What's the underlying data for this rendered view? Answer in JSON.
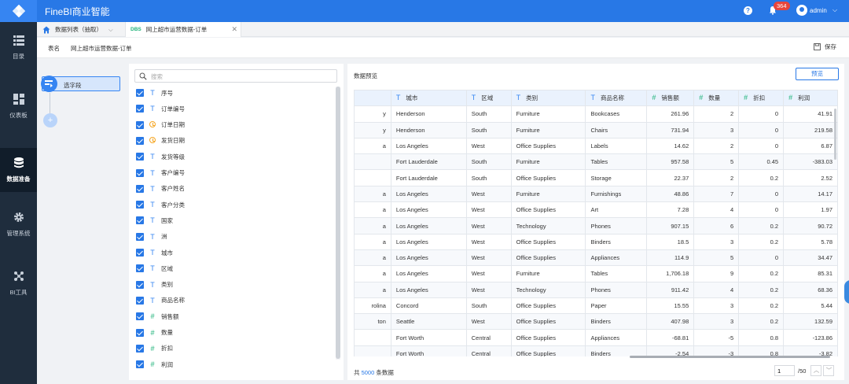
{
  "app": {
    "title": "FineBI商业智能"
  },
  "header": {
    "notification_count": "364",
    "user": "admin"
  },
  "rail": {
    "items": [
      {
        "label": "目录",
        "icon": "list-icon"
      },
      {
        "label": "仪表板",
        "icon": "dashboard-icon"
      },
      {
        "label": "数据准备",
        "icon": "database-icon",
        "active": true
      },
      {
        "label": "管理系统",
        "icon": "gear-icon"
      },
      {
        "label": "BI工具",
        "icon": "network-icon"
      }
    ]
  },
  "tabs": [
    {
      "label": "数据列表（抽取）"
    },
    {
      "badge": "DBS",
      "label": "网上超市运营数据-订单"
    }
  ],
  "namebar": {
    "label": "表名",
    "value": "网上超市运营数据-订单",
    "save": "保存"
  },
  "flow": {
    "node_label": "选字段",
    "add": "+"
  },
  "fields": {
    "search_placeholder": "搜索",
    "items": [
      {
        "type": "T",
        "name": "序号"
      },
      {
        "type": "T",
        "name": "订单编号"
      },
      {
        "type": "D",
        "name": "订单日期"
      },
      {
        "type": "D",
        "name": "发货日期"
      },
      {
        "type": "T",
        "name": "发货等级"
      },
      {
        "type": "T",
        "name": "客户编号"
      },
      {
        "type": "T",
        "name": "客户姓名"
      },
      {
        "type": "T",
        "name": "客户分类"
      },
      {
        "type": "T",
        "name": "国家"
      },
      {
        "type": "T",
        "name": "洲"
      },
      {
        "type": "T",
        "name": "城市"
      },
      {
        "type": "T",
        "name": "区域"
      },
      {
        "type": "T",
        "name": "类别"
      },
      {
        "type": "T",
        "name": "商品名称"
      },
      {
        "type": "#",
        "name": "销售额"
      },
      {
        "type": "#",
        "name": "数量"
      },
      {
        "type": "#",
        "name": "折扣"
      },
      {
        "type": "#",
        "name": "利润"
      }
    ]
  },
  "preview": {
    "title": "数据预览",
    "button": "预览",
    "columns": [
      {
        "type": "T",
        "name": ""
      },
      {
        "type": "T",
        "name": "城市"
      },
      {
        "type": "T",
        "name": "区域"
      },
      {
        "type": "T",
        "name": "类别"
      },
      {
        "type": "T",
        "name": "商品名称"
      },
      {
        "type": "#",
        "name": "销售额"
      },
      {
        "type": "#",
        "name": "数量"
      },
      {
        "type": "#",
        "name": "折扣"
      },
      {
        "type": "#",
        "name": "利润"
      }
    ],
    "rows": [
      [
        "y",
        "Henderson",
        "South",
        "Furniture",
        "Bookcases",
        "261.96",
        "2",
        "0",
        "41.91"
      ],
      [
        "y",
        "Henderson",
        "South",
        "Furniture",
        "Chairs",
        "731.94",
        "3",
        "0",
        "219.58"
      ],
      [
        "a",
        "Los Angeles",
        "West",
        "Office Supplies",
        "Labels",
        "14.62",
        "2",
        "0",
        "6.87"
      ],
      [
        "",
        "Fort Lauderdale",
        "South",
        "Furniture",
        "Tables",
        "957.58",
        "5",
        "0.45",
        "-383.03"
      ],
      [
        "",
        "Fort Lauderdale",
        "South",
        "Office Supplies",
        "Storage",
        "22.37",
        "2",
        "0.2",
        "2.52"
      ],
      [
        "a",
        "Los Angeles",
        "West",
        "Furniture",
        "Furnishings",
        "48.86",
        "7",
        "0",
        "14.17"
      ],
      [
        "a",
        "Los Angeles",
        "West",
        "Office Supplies",
        "Art",
        "7.28",
        "4",
        "0",
        "1.97"
      ],
      [
        "a",
        "Los Angeles",
        "West",
        "Technology",
        "Phones",
        "907.15",
        "6",
        "0.2",
        "90.72"
      ],
      [
        "a",
        "Los Angeles",
        "West",
        "Office Supplies",
        "Binders",
        "18.5",
        "3",
        "0.2",
        "5.78"
      ],
      [
        "a",
        "Los Angeles",
        "West",
        "Office Supplies",
        "Appliances",
        "114.9",
        "5",
        "0",
        "34.47"
      ],
      [
        "a",
        "Los Angeles",
        "West",
        "Furniture",
        "Tables",
        "1,706.18",
        "9",
        "0.2",
        "85.31"
      ],
      [
        "a",
        "Los Angeles",
        "West",
        "Technology",
        "Phones",
        "911.42",
        "4",
        "0.2",
        "68.36"
      ],
      [
        "rolina",
        "Concord",
        "South",
        "Office Supplies",
        "Paper",
        "15.55",
        "3",
        "0.2",
        "5.44"
      ],
      [
        "ton",
        "Seattle",
        "West",
        "Office Supplies",
        "Binders",
        "407.98",
        "3",
        "0.2",
        "132.59"
      ],
      [
        "",
        "Fort Worth",
        "Central",
        "Office Supplies",
        "Appliances",
        "-68.81",
        "-5",
        "0.8",
        "-123.86"
      ],
      [
        "",
        "Fort Worth",
        "Central",
        "Office Supplies",
        "Binders",
        "-2.54",
        "-3",
        "0.8",
        "-3.82"
      ]
    ],
    "footer_prefix": "共",
    "footer_total": "5000",
    "footer_suffix": "条数据",
    "page_value": "1",
    "page_total": "/50"
  }
}
